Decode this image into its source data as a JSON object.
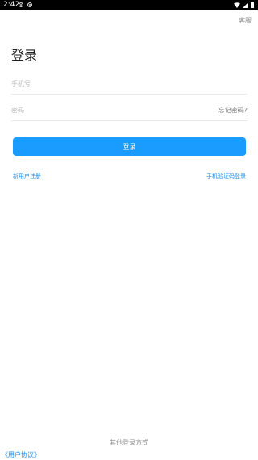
{
  "status_bar": {
    "time": "2:42",
    "left_icons": [
      "notification-icon",
      "notification-icon"
    ],
    "right_icons": [
      "wifi-icon",
      "cell-signal-icon",
      "battery-icon"
    ]
  },
  "header": {
    "service_label": "客服"
  },
  "page": {
    "title": "登录"
  },
  "form": {
    "phone_placeholder": "手机号",
    "phone_value": "",
    "password_placeholder": "密码",
    "password_value": "",
    "forgot_label": "忘记密码?",
    "login_label": "登录"
  },
  "links": {
    "register_label": "新用户注册",
    "sms_login_label": "手机验证码登录"
  },
  "footer": {
    "other_login_label": "其他登录方式",
    "agreement_label": "《用户协议》"
  },
  "colors": {
    "accent": "#1a9cff",
    "link": "#1a8df0",
    "status_bar": "#000000"
  }
}
